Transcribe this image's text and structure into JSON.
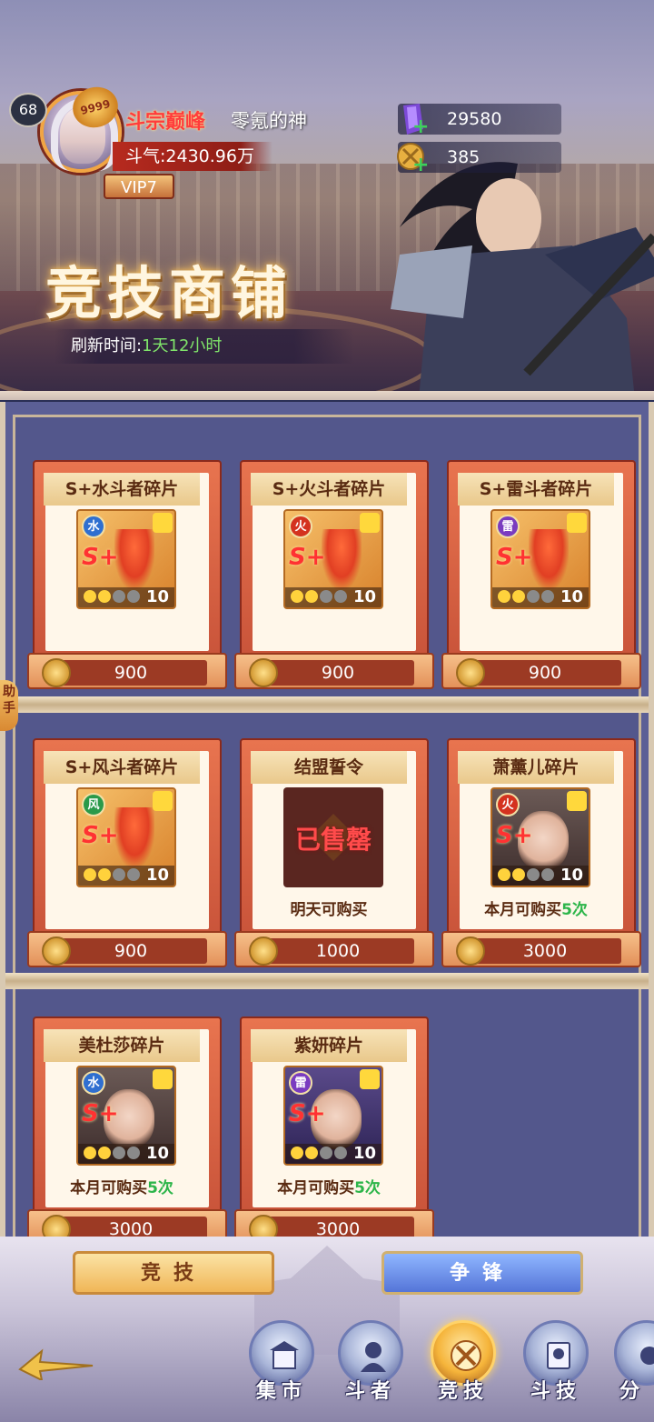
{
  "player": {
    "level": "68",
    "badge": "9999",
    "title": "斗宗巅峰",
    "name": "零氪的神",
    "power_label": "斗气:",
    "power_value": "2430.96万",
    "vip": "VIP7"
  },
  "currencies": [
    {
      "icon": "purple-crystal-icon",
      "value": "29580"
    },
    {
      "icon": "gold-coin-icon",
      "value": "385"
    }
  ],
  "shop": {
    "title": "竞技商铺",
    "refresh_label": "刷新时间:",
    "refresh_value": "1天12小时"
  },
  "helper_label": "助手",
  "items": [
    {
      "name": "S+水斗者碎片",
      "element": "水",
      "element_color": "#2f6fd0",
      "stars": "10",
      "price": "900"
    },
    {
      "name": "S+火斗者碎片",
      "element": "火",
      "element_color": "#d4321f",
      "stars": "10",
      "price": "900"
    },
    {
      "name": "S+雷斗者碎片",
      "element": "雷",
      "element_color": "#7a3cc0",
      "stars": "10",
      "price": "900"
    },
    {
      "name": "S+风斗者碎片",
      "element": "风",
      "element_color": "#2a9a4a",
      "stars": "10",
      "price": "900"
    },
    {
      "name": "结盟誓令",
      "soldout": "已售罄",
      "limit_text": "明天可购买",
      "price": "1000"
    },
    {
      "name": "萧薰儿碎片",
      "element": "火",
      "element_color": "#d4321f",
      "stars": "10",
      "limit_prefix": "本月可购买",
      "limit_num": "5次",
      "price": "3000"
    },
    {
      "name": "美杜莎碎片",
      "element": "水",
      "element_color": "#2f6fd0",
      "stars": "10",
      "limit_prefix": "本月可购买",
      "limit_num": "5次",
      "price": "3000"
    },
    {
      "name": "紫妍碎片",
      "element": "雷",
      "element_color": "#7a3cc0",
      "stars": "10",
      "limit_prefix": "本月可购买",
      "limit_num": "5次",
      "price": "3000"
    }
  ],
  "tabs": {
    "arena": "竞技",
    "contend": "争锋"
  },
  "nav": [
    {
      "label": "集市",
      "icon": "market-icon"
    },
    {
      "label": "斗者",
      "icon": "fighter-icon"
    },
    {
      "label": "竞技",
      "icon": "arena-icon",
      "active": true
    },
    {
      "label": "斗技",
      "icon": "skill-icon"
    },
    {
      "label": "分",
      "icon": "share-icon"
    }
  ],
  "colors": {
    "shelf_bg": "#53578c",
    "price_green": "#2db54a",
    "accent_gold": "#f0b657"
  }
}
